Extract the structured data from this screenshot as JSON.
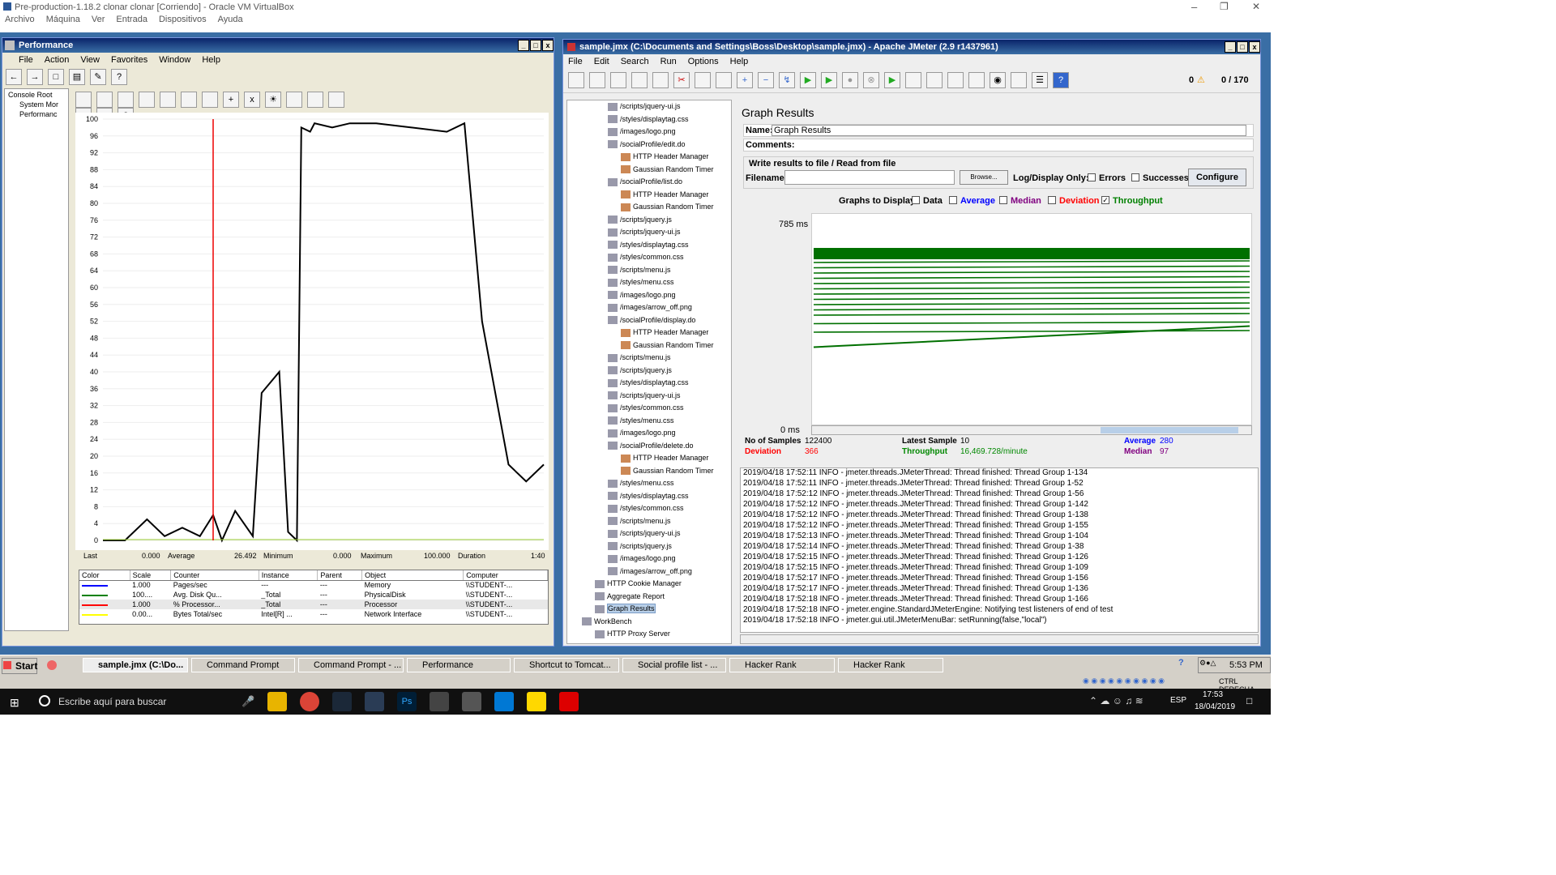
{
  "vbox": {
    "title": "Pre-production-1.18.2 clonar clonar [Corriendo] - Oracle VM VirtualBox",
    "menus": [
      "Archivo",
      "Máquina",
      "Ver",
      "Entrada",
      "Dispositivos",
      "Ayuda"
    ]
  },
  "perf": {
    "title": "Performance",
    "menus": [
      "File",
      "Action",
      "View",
      "Favorites",
      "Window",
      "Help"
    ],
    "tree": [
      "Console Root",
      "System Mor",
      "Performanc"
    ],
    "yticks": [
      "100",
      "96",
      "92",
      "88",
      "84",
      "80",
      "76",
      "72",
      "68",
      "64",
      "60",
      "56",
      "52",
      "48",
      "44",
      "40",
      "36",
      "32",
      "28",
      "24",
      "20",
      "16",
      "12",
      "8",
      "4",
      "0"
    ],
    "stats": {
      "last_l": "Last",
      "last": "0.000",
      "avg_l": "Average",
      "avg": "26.492",
      "min_l": "Minimum",
      "min": "0.000",
      "max_l": "Maximum",
      "max": "100.000",
      "dur_l": "Duration",
      "dur": "1:40"
    },
    "legend_headers": [
      "Color",
      "Scale",
      "Counter",
      "Instance",
      "Parent",
      "Object",
      "Computer"
    ],
    "legend_rows": [
      {
        "color": "#0000ff",
        "scale": "1.000",
        "counter": "Pages/sec",
        "instance": "---",
        "parent": "---",
        "object": "Memory",
        "computer": "\\\\STUDENT-..."
      },
      {
        "color": "#008000",
        "scale": "100....",
        "counter": "Avg. Disk Qu...",
        "instance": "_Total",
        "parent": "---",
        "object": "PhysicalDisk",
        "computer": "\\\\STUDENT-..."
      },
      {
        "color": "#ff0000",
        "scale": "1.000",
        "counter": "% Processor...",
        "instance": "_Total",
        "parent": "---",
        "object": "Processor",
        "computer": "\\\\STUDENT-..."
      },
      {
        "color": "#ffff00",
        "scale": "0.00...",
        "counter": "Bytes Total/sec",
        "instance": "Intel[R] ...",
        "parent": "---",
        "object": "Network Interface",
        "computer": "\\\\STUDENT-..."
      }
    ]
  },
  "jm": {
    "title": "sample.jmx (C:\\Documents and Settings\\Boss\\Desktop\\sample.jmx) - Apache JMeter (2.9 r1437961)",
    "menus": [
      "File",
      "Edit",
      "Search",
      "Run",
      "Options",
      "Help"
    ],
    "warn_count": "0",
    "threads": "0 / 170",
    "tree": [
      {
        "label": "/scripts/jquery-ui.js",
        "indent": 0
      },
      {
        "label": "/styles/displaytag.css",
        "indent": 0
      },
      {
        "label": "/images/logo.png",
        "indent": 0
      },
      {
        "label": "/socialProfile/edit.do",
        "indent": 0
      },
      {
        "label": "HTTP Header Manager",
        "indent": 1
      },
      {
        "label": "Gaussian Random Timer",
        "indent": 1
      },
      {
        "label": "/socialProfile/list.do",
        "indent": 0
      },
      {
        "label": "HTTP Header Manager",
        "indent": 1
      },
      {
        "label": "Gaussian Random Timer",
        "indent": 1
      },
      {
        "label": "/scripts/jquery.js",
        "indent": 0
      },
      {
        "label": "/scripts/jquery-ui.js",
        "indent": 0
      },
      {
        "label": "/styles/displaytag.css",
        "indent": 0
      },
      {
        "label": "/styles/common.css",
        "indent": 0
      },
      {
        "label": "/scripts/menu.js",
        "indent": 0
      },
      {
        "label": "/styles/menu.css",
        "indent": 0
      },
      {
        "label": "/images/logo.png",
        "indent": 0
      },
      {
        "label": "/images/arrow_off.png",
        "indent": 0
      },
      {
        "label": "/socialProfile/display.do",
        "indent": 0
      },
      {
        "label": "HTTP Header Manager",
        "indent": 1
      },
      {
        "label": "Gaussian Random Timer",
        "indent": 1
      },
      {
        "label": "/scripts/menu.js",
        "indent": 0
      },
      {
        "label": "/scripts/jquery.js",
        "indent": 0
      },
      {
        "label": "/styles/displaytag.css",
        "indent": 0
      },
      {
        "label": "/scripts/jquery-ui.js",
        "indent": 0
      },
      {
        "label": "/styles/common.css",
        "indent": 0
      },
      {
        "label": "/styles/menu.css",
        "indent": 0
      },
      {
        "label": "/images/logo.png",
        "indent": 0
      },
      {
        "label": "/socialProfile/delete.do",
        "indent": 0
      },
      {
        "label": "HTTP Header Manager",
        "indent": 1
      },
      {
        "label": "Gaussian Random Timer",
        "indent": 1
      },
      {
        "label": "/styles/menu.css",
        "indent": 0
      },
      {
        "label": "/styles/displaytag.css",
        "indent": 0
      },
      {
        "label": "/styles/common.css",
        "indent": 0
      },
      {
        "label": "/scripts/menu.js",
        "indent": 0
      },
      {
        "label": "/scripts/jquery-ui.js",
        "indent": 0
      },
      {
        "label": "/scripts/jquery.js",
        "indent": 0
      },
      {
        "label": "/images/logo.png",
        "indent": 0
      },
      {
        "label": "/images/arrow_off.png",
        "indent": 0
      },
      {
        "label": "HTTP Cookie Manager",
        "indent": -1
      },
      {
        "label": "Aggregate Report",
        "indent": -1
      },
      {
        "label": "Graph Results",
        "indent": -1,
        "selected": true
      },
      {
        "label": "WorkBench",
        "indent": -2
      },
      {
        "label": "HTTP Proxy Server",
        "indent": -1
      }
    ],
    "graph": {
      "heading": "Graph Results",
      "name_l": "Name:",
      "name": "Graph Results",
      "comments_l": "Comments:",
      "write_l": "Write results to file / Read from file",
      "filename_l": "Filename",
      "browse": "Browse...",
      "logdisplay": "Log/Display Only:",
      "errors": "Errors",
      "successes": "Successes",
      "configure": "Configure",
      "display_l": "Graphs to Display",
      "cb_data": "Data",
      "cb_average": "Average",
      "cb_median": "Median",
      "cb_deviation": "Deviation",
      "cb_throughput": "Throughput",
      "ymax": "785  ms",
      "ymin": "0  ms",
      "samples_l": "No of Samples",
      "samples": "122400",
      "latest_l": "Latest Sample",
      "latest": "10",
      "average_l": "Average",
      "average": "280",
      "deviation_l": "Deviation",
      "deviation": "366",
      "throughput_l": "Throughput",
      "throughput": "16,469.728/minute",
      "median_l": "Median",
      "median": "97",
      "colors": {
        "average": "#0000ff",
        "median": "#800080",
        "deviation": "#ff0000",
        "throughput": "#008000"
      }
    },
    "log": [
      "2019/04/18 17:52:11 INFO  - jmeter.threads.JMeterThread: Thread finished: Thread Group 1-134",
      "2019/04/18 17:52:11 INFO  - jmeter.threads.JMeterThread: Thread finished: Thread Group 1-52",
      "2019/04/18 17:52:12 INFO  - jmeter.threads.JMeterThread: Thread finished: Thread Group 1-56",
      "2019/04/18 17:52:12 INFO  - jmeter.threads.JMeterThread: Thread finished: Thread Group 1-142",
      "2019/04/18 17:52:12 INFO  - jmeter.threads.JMeterThread: Thread finished: Thread Group 1-138",
      "2019/04/18 17:52:12 INFO  - jmeter.threads.JMeterThread: Thread finished: Thread Group 1-155",
      "2019/04/18 17:52:13 INFO  - jmeter.threads.JMeterThread: Thread finished: Thread Group 1-104",
      "2019/04/18 17:52:14 INFO  - jmeter.threads.JMeterThread: Thread finished: Thread Group 1-38",
      "2019/04/18 17:52:15 INFO  - jmeter.threads.JMeterThread: Thread finished: Thread Group 1-126",
      "2019/04/18 17:52:15 INFO  - jmeter.threads.JMeterThread: Thread finished: Thread Group 1-109",
      "2019/04/18 17:52:17 INFO  - jmeter.threads.JMeterThread: Thread finished: Thread Group 1-156",
      "2019/04/18 17:52:17 INFO  - jmeter.threads.JMeterThread: Thread finished: Thread Group 1-136",
      "2019/04/18 17:52:18 INFO  - jmeter.threads.JMeterThread: Thread finished: Thread Group 1-166",
      "2019/04/18 17:52:18 INFO  - jmeter.engine.StandardJMeterEngine: Notifying test listeners of end of test",
      "2019/04/18 17:52:18 INFO  - jmeter.gui.util.JMeterMenuBar: setRunning(false,\"local\")"
    ]
  },
  "xp": {
    "start": "Start",
    "tasks": [
      "sample.jmx (C:\\Do...",
      "Command Prompt",
      "Command Prompt - ...",
      "Performance",
      "Shortcut to Tomcat...",
      "Social profile list - ...",
      "Hacker Rank",
      "Hacker Rank"
    ],
    "clock": "5:53 PM",
    "host": "CTRL DERECHA"
  },
  "win10": {
    "search": "Escribe aquí para buscar",
    "lang": "ESP",
    "time": "17:53",
    "date": "18/04/2019"
  },
  "chart_data": [
    {
      "type": "line",
      "title": "",
      "ylim": [
        0,
        100
      ],
      "x": [
        0,
        5,
        10,
        14,
        18,
        22,
        25,
        27,
        30,
        34,
        36,
        40,
        42,
        44,
        45,
        47,
        48,
        52,
        56,
        62,
        70,
        78,
        82,
        86,
        92,
        96,
        100
      ],
      "series": [
        {
          "name": "% Processor...",
          "values": [
            0,
            0,
            5,
            1,
            3,
            1,
            6,
            0,
            7,
            1,
            35,
            40,
            2,
            0,
            98,
            97,
            99,
            98,
            99,
            99,
            98,
            97,
            99,
            52,
            18,
            14,
            18
          ]
        },
        {
          "name": "Avg. Disk Qu...",
          "values": [
            0,
            0,
            0,
            0,
            0,
            0,
            0,
            0,
            0,
            0,
            0,
            0,
            0,
            0,
            0,
            0,
            0,
            0,
            0,
            0,
            0,
            0,
            0,
            0,
            0,
            0,
            0
          ]
        }
      ]
    },
    {
      "type": "line",
      "title": "Graph Results",
      "ylim": [
        0,
        785
      ],
      "series": [
        {
          "name": "Throughput",
          "values": []
        }
      ]
    }
  ]
}
